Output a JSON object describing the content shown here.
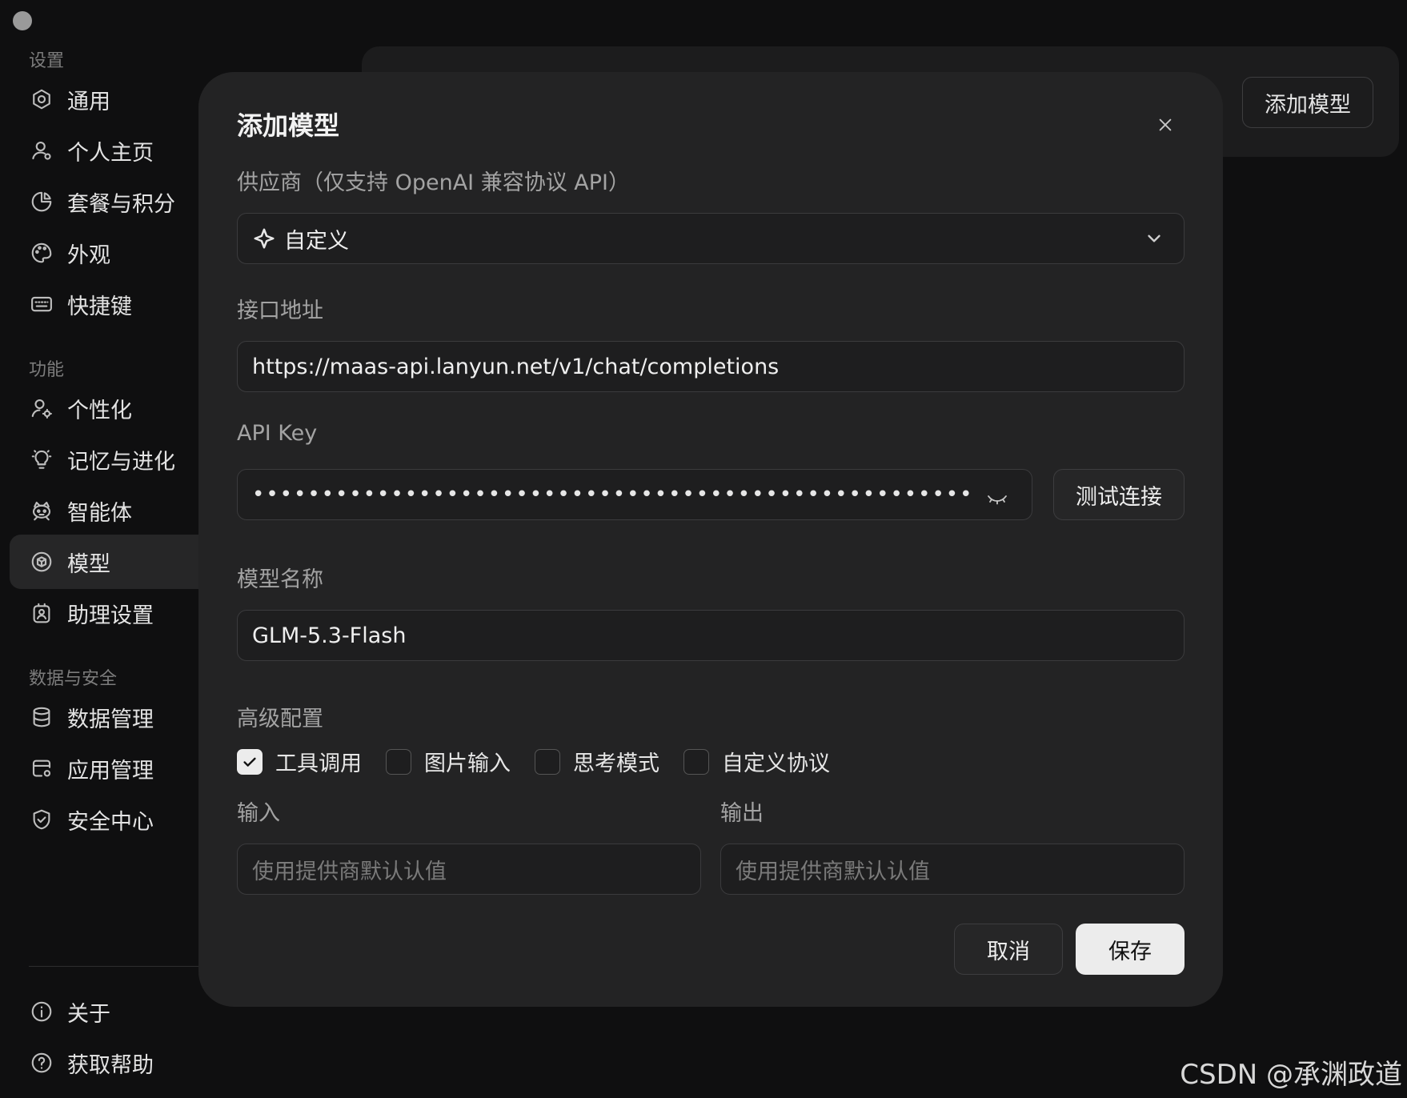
{
  "sidebar": {
    "sections": [
      {
        "title": "设置",
        "items": [
          {
            "label": "通用",
            "icon": "gear-icon"
          },
          {
            "label": "个人主页",
            "icon": "user-icon"
          },
          {
            "label": "套餐与积分",
            "icon": "pie-chart-icon"
          },
          {
            "label": "外观",
            "icon": "palette-icon"
          },
          {
            "label": "快捷键",
            "icon": "keyboard-icon"
          }
        ]
      },
      {
        "title": "功能",
        "items": [
          {
            "label": "个性化",
            "icon": "user-gear-icon"
          },
          {
            "label": "记忆与进化",
            "icon": "lightbulb-icon"
          },
          {
            "label": "智能体",
            "icon": "robot-icon"
          },
          {
            "label": "模型",
            "icon": "cube-icon",
            "active": true
          },
          {
            "label": "助理设置",
            "icon": "assistant-icon"
          }
        ]
      },
      {
        "title": "数据与安全",
        "items": [
          {
            "label": "数据管理",
            "icon": "database-icon"
          },
          {
            "label": "应用管理",
            "icon": "app-icon"
          },
          {
            "label": "安全中心",
            "icon": "shield-icon"
          }
        ]
      }
    ],
    "footer_items": [
      {
        "label": "关于",
        "icon": "info-icon"
      },
      {
        "label": "获取帮助",
        "icon": "help-icon"
      }
    ]
  },
  "background": {
    "add_model_button": "添加模型"
  },
  "modal": {
    "title": "添加模型",
    "provider": {
      "label": "供应商（仅支持 OpenAI 兼容协议 API）",
      "value": "自定义"
    },
    "endpoint": {
      "label": "接口地址",
      "value": "https://maas-api.lanyun.net/v1/chat/completions"
    },
    "api_key": {
      "label": "API Key",
      "masked_value": "••••••••••••••••••••••••••••••••••••••••••••••••••••",
      "test_button": "测试连接"
    },
    "model_name": {
      "label": "模型名称",
      "value": "GLM-5.3-Flash"
    },
    "advanced": {
      "label": "高级配置",
      "options": [
        {
          "label": "工具调用",
          "checked": true
        },
        {
          "label": "图片输入",
          "checked": false
        },
        {
          "label": "思考模式",
          "checked": false
        },
        {
          "label": "自定义协议",
          "checked": false
        }
      ]
    },
    "input": {
      "label": "输入",
      "placeholder": "使用提供商默认认值"
    },
    "output": {
      "label": "输出",
      "placeholder": "使用提供商默认认值"
    },
    "cancel_button": "取消",
    "save_button": "保存"
  },
  "watermark": "CSDN @承渊政道"
}
